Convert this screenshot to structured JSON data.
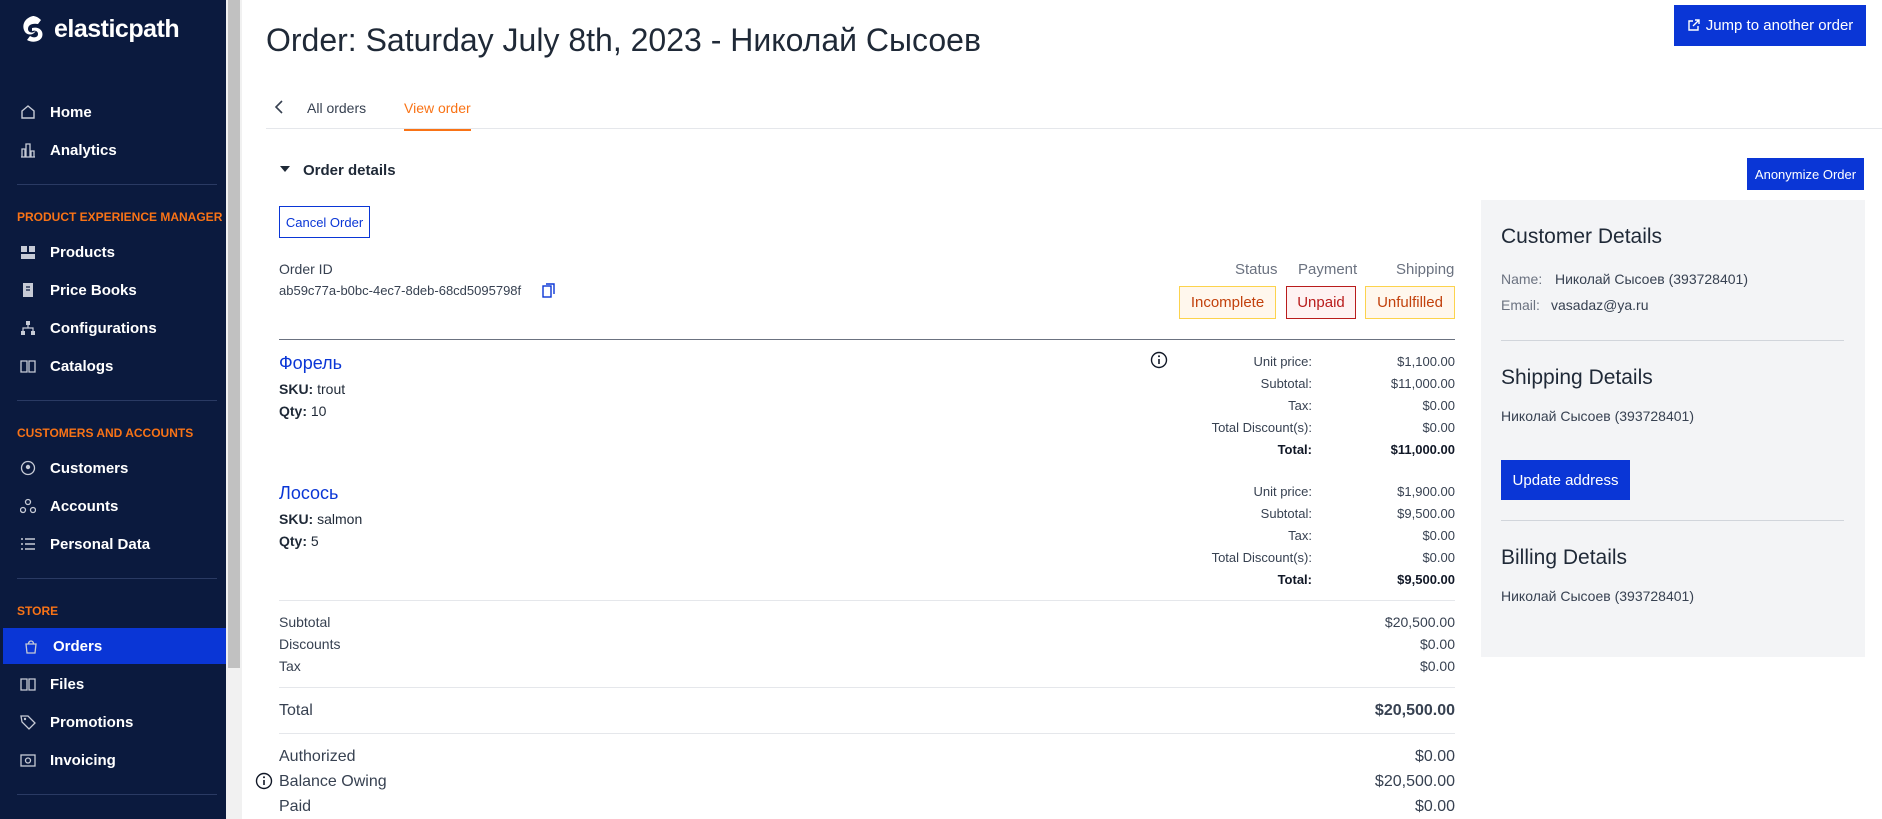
{
  "brand": {
    "name": "elasticpath"
  },
  "sidebar": {
    "top_items": [
      {
        "label": "Home",
        "icon": "home-icon"
      },
      {
        "label": "Analytics",
        "icon": "analytics-icon"
      }
    ],
    "sections": [
      {
        "title": "PRODUCT EXPERIENCE MANAGER",
        "items": [
          {
            "label": "Products",
            "icon": "products-icon"
          },
          {
            "label": "Price Books",
            "icon": "price-books-icon"
          },
          {
            "label": "Configurations",
            "icon": "configurations-icon"
          },
          {
            "label": "Catalogs",
            "icon": "catalogs-icon"
          }
        ]
      },
      {
        "title": "CUSTOMERS AND ACCOUNTS",
        "items": [
          {
            "label": "Customers",
            "icon": "customers-icon"
          },
          {
            "label": "Accounts",
            "icon": "accounts-icon"
          },
          {
            "label": "Personal Data",
            "icon": "personal-data-icon"
          }
        ]
      },
      {
        "title": "STORE",
        "items": [
          {
            "label": "Orders",
            "icon": "orders-icon",
            "active": true
          },
          {
            "label": "Files",
            "icon": "files-icon"
          },
          {
            "label": "Promotions",
            "icon": "promotions-icon"
          },
          {
            "label": "Invoicing",
            "icon": "invoicing-icon"
          }
        ]
      }
    ]
  },
  "header": {
    "title": "Order: Saturday July 8th, 2023 - Николай Сысоев",
    "jump_button": "Jump to another order"
  },
  "tabs": {
    "all": "All orders",
    "view": "View order"
  },
  "order_details": {
    "section_title": "Order details",
    "anonymize_button": "Anonymize Order",
    "cancel_button": "Cancel Order",
    "order_id_label": "Order ID",
    "order_id": "ab59c77a-b0bc-4ec7-8deb-68cd5095798f",
    "status_headers": {
      "status": "Status",
      "payment": "Payment",
      "shipping": "Shipping"
    },
    "status_badges": {
      "status": "Incomplete",
      "payment": "Unpaid",
      "shipping": "Unfulfilled"
    },
    "colors": {
      "accent": "#0a36d6",
      "warning": "#c2410c",
      "danger": "#b91c1c",
      "sidebar": "#0b1a3e"
    }
  },
  "items": [
    {
      "name": "Форель",
      "sku_label": "SKU:",
      "sku": "trout",
      "qty_label": "Qty:",
      "qty": "10",
      "prices": {
        "unit_price_label": "Unit price:",
        "unit_price": "$1,100.00",
        "subtotal_label": "Subtotal:",
        "subtotal": "$11,000.00",
        "tax_label": "Tax:",
        "tax": "$0.00",
        "discount_label": "Total Discount(s):",
        "discount": "$0.00",
        "total_label": "Total:",
        "total": "$11,000.00"
      }
    },
    {
      "name": "Лосось",
      "sku_label": "SKU:",
      "sku": "salmon",
      "qty_label": "Qty:",
      "qty": "5",
      "prices": {
        "unit_price_label": "Unit price:",
        "unit_price": "$1,900.00",
        "subtotal_label": "Subtotal:",
        "subtotal": "$9,500.00",
        "tax_label": "Tax:",
        "tax": "$0.00",
        "discount_label": "Total Discount(s):",
        "discount": "$0.00",
        "total_label": "Total:",
        "total": "$9,500.00"
      }
    }
  ],
  "summary": {
    "subtotal_label": "Subtotal",
    "subtotal": "$20,500.00",
    "discounts_label": "Discounts",
    "discounts": "$0.00",
    "tax_label": "Tax",
    "tax": "$0.00",
    "total_label": "Total",
    "total": "$20,500.00",
    "authorized_label": "Authorized",
    "authorized": "$0.00",
    "balance_label": "Balance Owing",
    "balance": "$20,500.00",
    "paid_label": "Paid",
    "paid": "$0.00"
  },
  "customer": {
    "title": "Customer Details",
    "name_label": "Name:",
    "name": "Николай Сысоев (393728401)",
    "email_label": "Email:",
    "email": "vasadaz@ya.ru"
  },
  "shipping": {
    "title": "Shipping Details",
    "name": "Николай Сысоев (393728401)",
    "update_button": "Update address"
  },
  "billing": {
    "title": "Billing Details",
    "name": "Николай Сысоев (393728401)"
  }
}
